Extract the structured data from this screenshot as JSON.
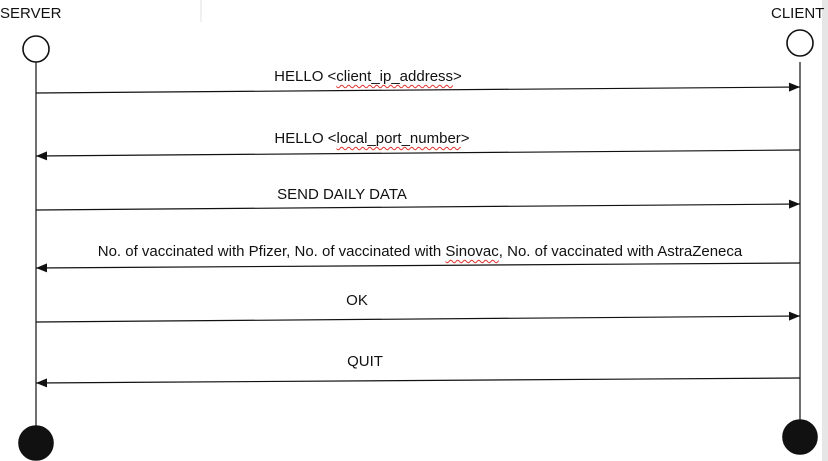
{
  "participants": {
    "server": "SERVER",
    "client": "CLIENT"
  },
  "messages": [
    {
      "direction": "server-to-client",
      "parts": [
        {
          "t": "HELLO <"
        },
        {
          "t": "client_ip_address",
          "spell": true
        },
        {
          "t": ">"
        }
      ]
    },
    {
      "direction": "client-to-server",
      "parts": [
        {
          "t": "HELLO <"
        },
        {
          "t": "local_port_number",
          "spell": true
        },
        {
          "t": ">"
        }
      ]
    },
    {
      "direction": "server-to-client",
      "parts": [
        {
          "t": "SEND DAILY DATA"
        }
      ]
    },
    {
      "direction": "client-to-server",
      "parts": [
        {
          "t": "No. of vaccinated with Pfizer, No. of vaccinated with "
        },
        {
          "t": "Sinovac",
          "spell": true
        },
        {
          "t": ", No. of vaccinated with AstraZeneca"
        }
      ]
    },
    {
      "direction": "server-to-client",
      "parts": [
        {
          "t": "OK"
        }
      ]
    },
    {
      "direction": "client-to-server",
      "parts": [
        {
          "t": "QUIT"
        }
      ]
    }
  ],
  "colors": {
    "line": "#111111",
    "spellcheck": "#e0302a",
    "background": "#ffffff"
  }
}
